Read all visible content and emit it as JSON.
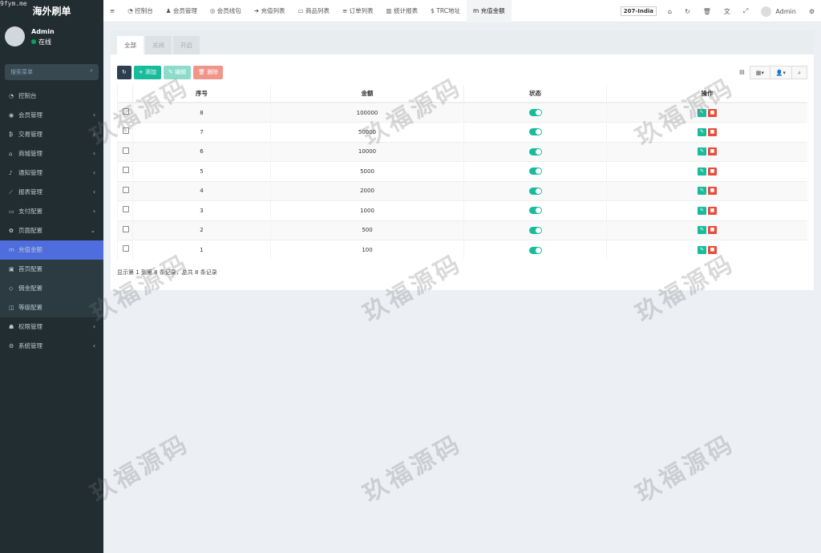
{
  "site_label": "9fym.me",
  "app_title": "海外刷单",
  "user": {
    "name": "Admin",
    "status": "在线"
  },
  "sidebar": {
    "search_placeholder": "搜索菜单",
    "items": [
      {
        "label": "控制台",
        "icon": "dashboard-icon"
      },
      {
        "label": "会员管理",
        "icon": "user-circle-icon"
      },
      {
        "label": "交易管理",
        "icon": "bitcoin-icon"
      },
      {
        "label": "商城管理",
        "icon": "home-icon"
      },
      {
        "label": "通知管理",
        "icon": "bell-icon"
      },
      {
        "label": "报表管理",
        "icon": "chart-line-icon"
      },
      {
        "label": "支付配置",
        "icon": "credit-card-icon"
      },
      {
        "label": "页面配置",
        "icon": "gear-icon"
      },
      {
        "label": "充值金额",
        "icon": "m-icon"
      },
      {
        "label": "首页配置",
        "icon": "image-icon"
      },
      {
        "label": "佣金配置",
        "icon": "diamond-icon"
      },
      {
        "label": "等级配置",
        "icon": "level-icon"
      },
      {
        "label": "权限管理",
        "icon": "users-icon"
      },
      {
        "label": "系统管理",
        "icon": "cogs-icon"
      }
    ]
  },
  "topnav": {
    "tabs": [
      "控制台",
      "会员管理",
      "会员线包",
      "充值列表",
      "商品列表",
      "订单列表",
      "统计报表",
      "TRC地址",
      "充值金额"
    ],
    "region": "207-India",
    "admin": "Admin"
  },
  "filter_tabs": [
    "全部",
    "关闭",
    "开启"
  ],
  "toolbar": {
    "add": "添加",
    "edit": "编辑",
    "delete": "删除"
  },
  "table": {
    "headers": [
      "序号",
      "金额",
      "状态",
      "操作"
    ],
    "rows": [
      {
        "id": "8",
        "amount": "100000",
        "enabled": true
      },
      {
        "id": "7",
        "amount": "50000",
        "enabled": true
      },
      {
        "id": "6",
        "amount": "10000",
        "enabled": true
      },
      {
        "id": "5",
        "amount": "5000",
        "enabled": true
      },
      {
        "id": "4",
        "amount": "2000",
        "enabled": true
      },
      {
        "id": "3",
        "amount": "1000",
        "enabled": true
      },
      {
        "id": "2",
        "amount": "500",
        "enabled": true
      },
      {
        "id": "1",
        "amount": "100",
        "enabled": true
      }
    ]
  },
  "pagination_text": "显示第 1 到第 8 条记录，总共 8 条记录",
  "watermark": "玖福源码",
  "colors": {
    "sidebar": "#222d32",
    "active": "#4f6ddd",
    "success": "#18bc9c",
    "danger": "#e74c3c",
    "dark": "#2c3e50"
  }
}
